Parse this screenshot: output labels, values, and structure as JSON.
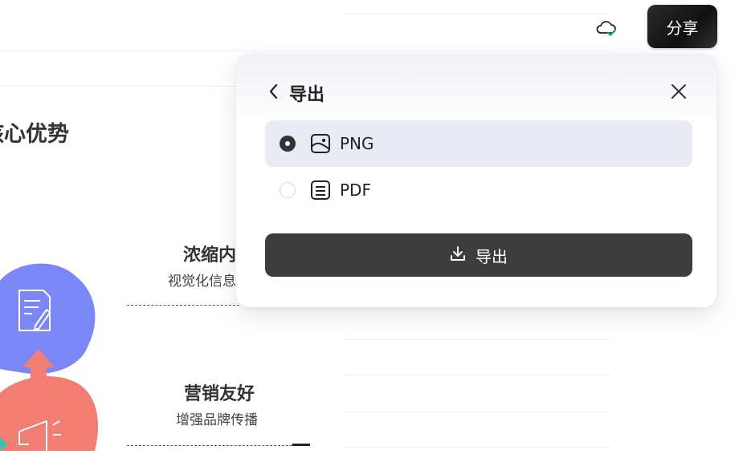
{
  "topbar": {
    "share_label": "分享",
    "cloud_icon": "cloud-check-icon"
  },
  "background": {
    "section_title": "核心优势",
    "features": [
      {
        "title": "浓缩内",
        "subtitle": "视觉化信息"
      },
      {
        "title": "营销友好",
        "subtitle": "增强品牌传播"
      }
    ]
  },
  "export_panel": {
    "title": "导出",
    "options": [
      {
        "label": "PNG",
        "icon": "image-icon",
        "selected": true
      },
      {
        "label": "PDF",
        "icon": "document-icon",
        "selected": false
      }
    ],
    "export_button_label": "导出"
  },
  "colors": {
    "blob_purple": "#7b86f7",
    "blob_coral": "#f27d73",
    "accent_teal": "#3cc0b0",
    "button_dark": "#3d3d3d",
    "selected_bg": "#e9ebf4",
    "check_green": "#1aaf5d"
  }
}
